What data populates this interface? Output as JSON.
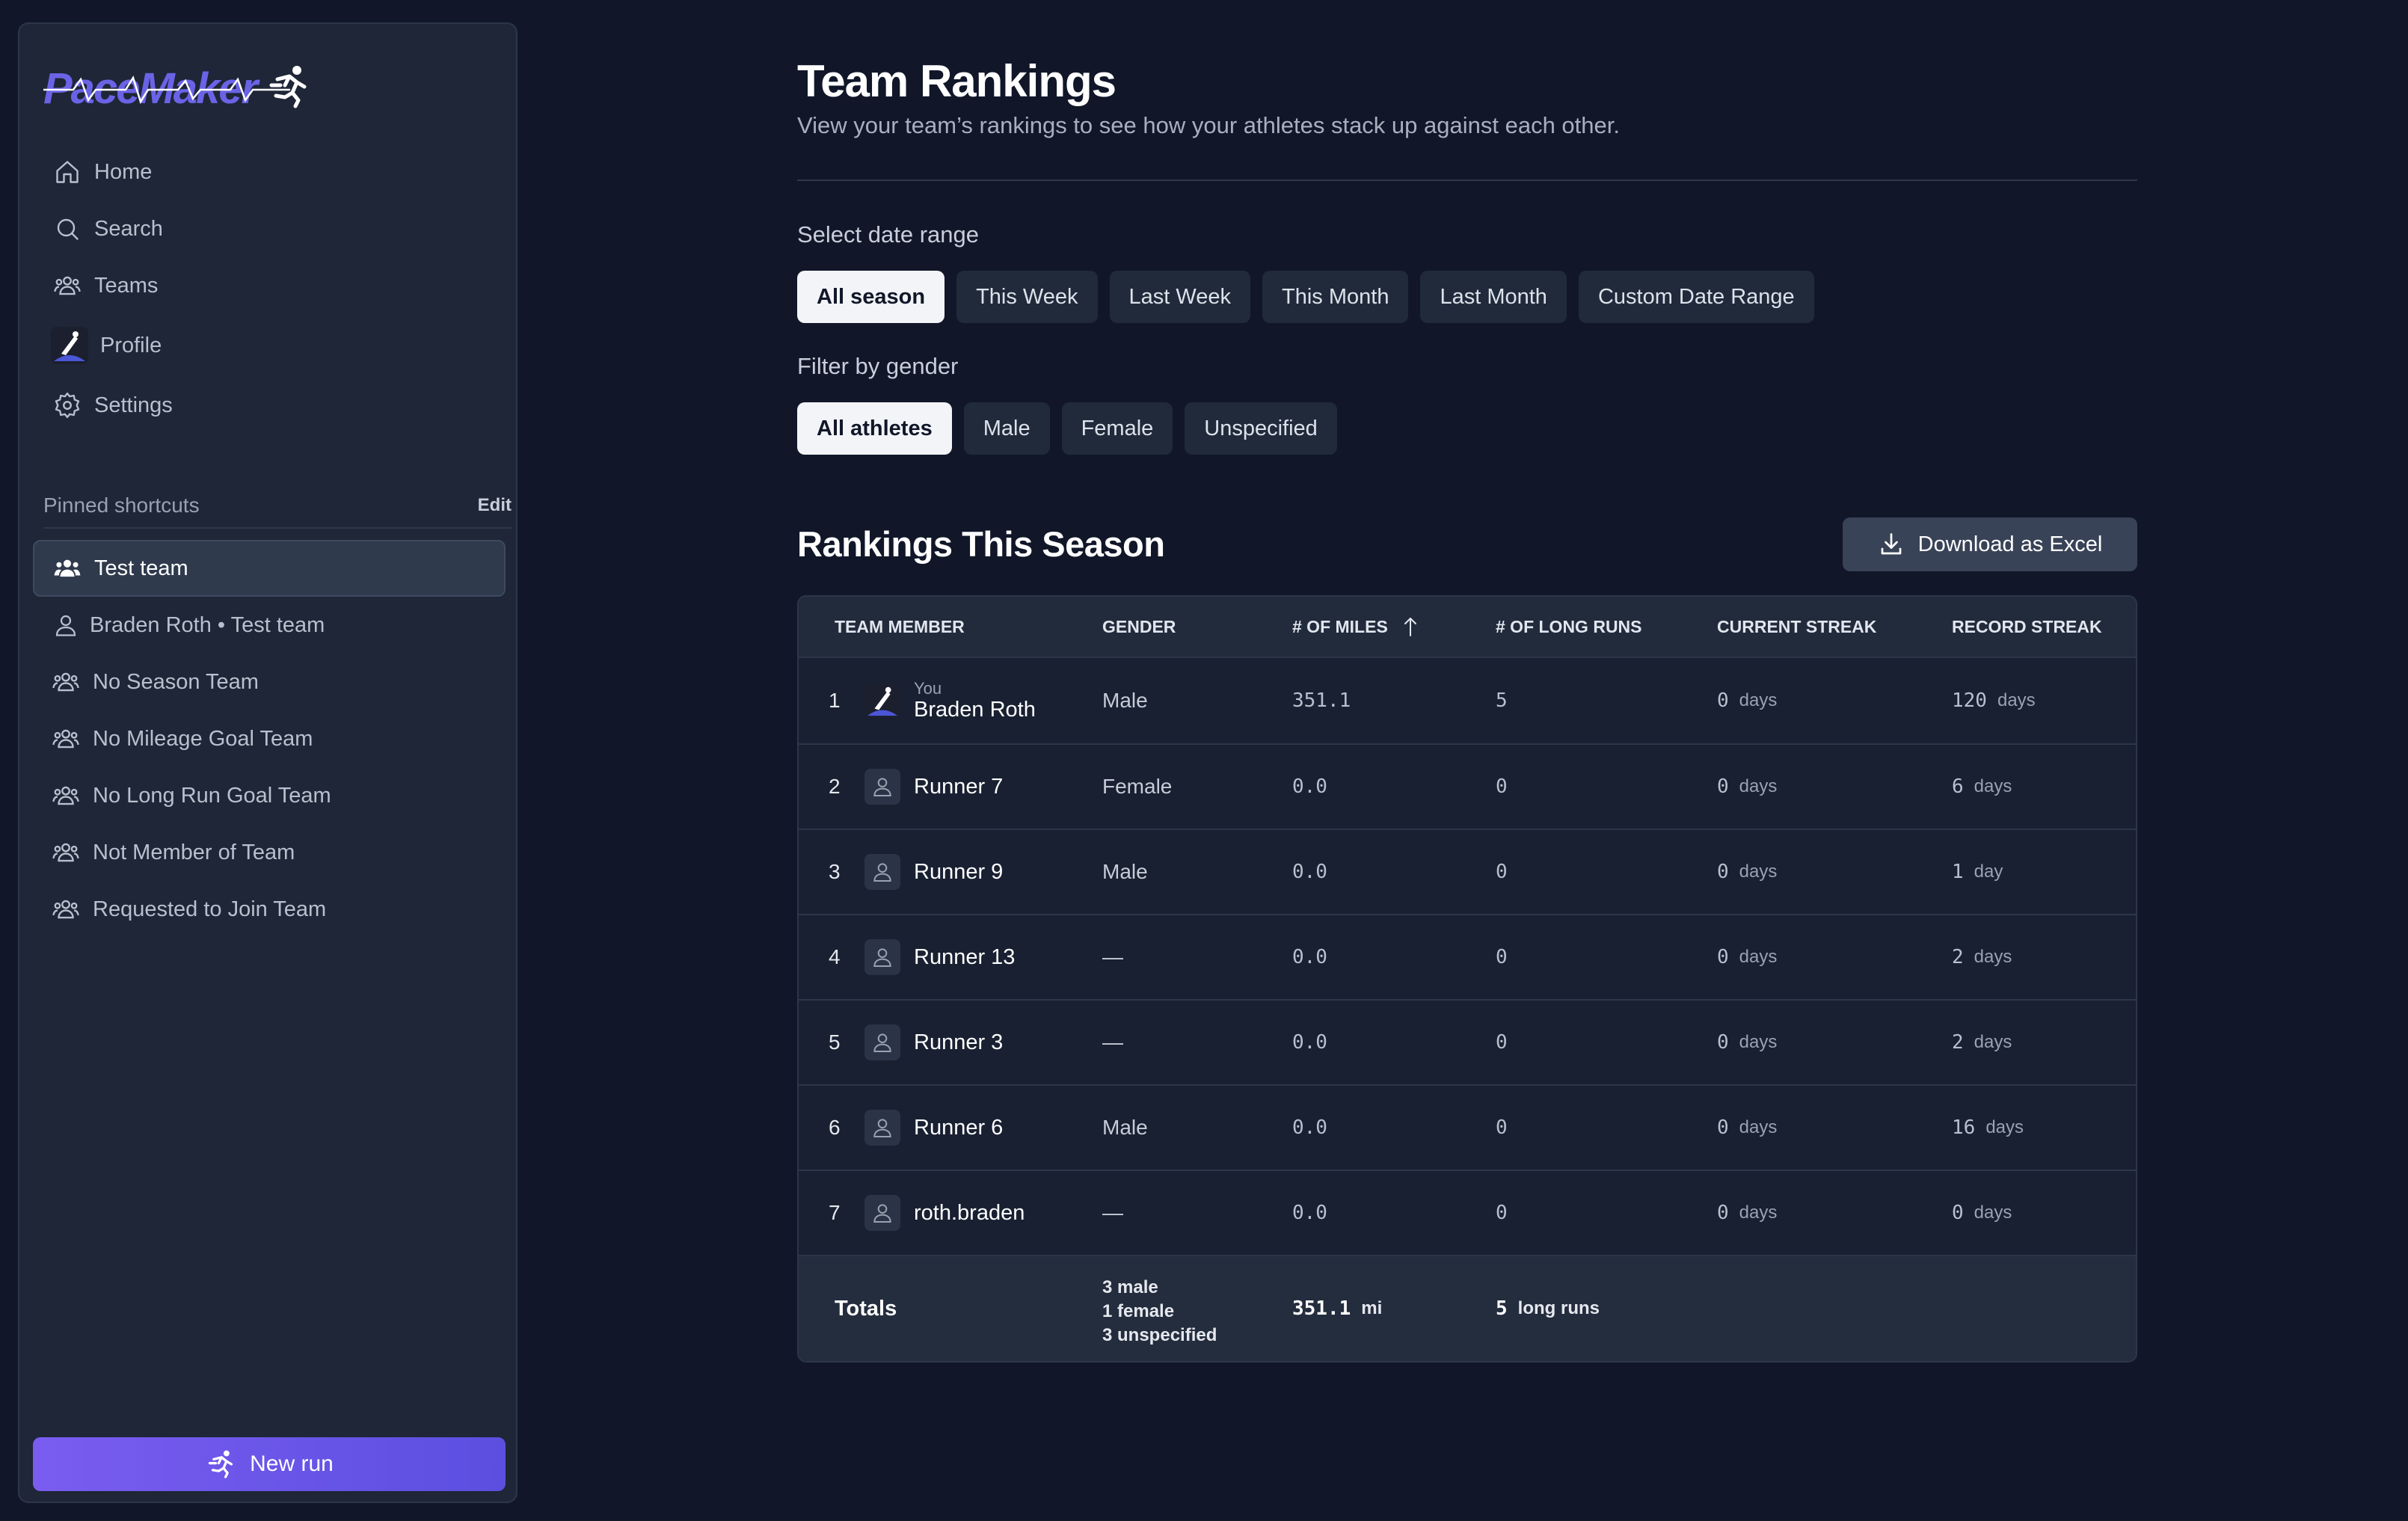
{
  "app": {
    "logo_text": "PaceMaker"
  },
  "nav": [
    {
      "label": "Home",
      "icon": "home-icon"
    },
    {
      "label": "Search",
      "icon": "search-icon"
    },
    {
      "label": "Teams",
      "icon": "users-icon"
    },
    {
      "label": "Profile",
      "icon": "avatar"
    },
    {
      "label": "Settings",
      "icon": "gear-icon"
    }
  ],
  "pinned": {
    "heading": "Pinned shortcuts",
    "edit_label": "Edit",
    "items": [
      {
        "label": "Test team",
        "active": true
      },
      {
        "label": "Braden Roth • Test team"
      },
      {
        "label": "No Season Team"
      },
      {
        "label": "No Mileage Goal Team"
      },
      {
        "label": "No Long Run Goal Team"
      },
      {
        "label": "Not Member of Team"
      },
      {
        "label": "Requested to Join Team"
      }
    ]
  },
  "new_run_label": "New run",
  "page": {
    "title": "Team Rankings",
    "subtitle": "View your team’s rankings to see how your athletes stack up against each other."
  },
  "date_range": {
    "label": "Select date range",
    "options": [
      "All season",
      "This Week",
      "Last Week",
      "This Month",
      "Last Month",
      "Custom Date Range"
    ],
    "selected": "All season"
  },
  "gender_filter": {
    "label": "Filter by gender",
    "options": [
      "All athletes",
      "Male",
      "Female",
      "Unspecified"
    ],
    "selected": "All athletes"
  },
  "rankings": {
    "title": "Rankings This Season",
    "download_label": "Download as Excel",
    "columns": [
      "TEAM MEMBER",
      "GENDER",
      "# OF MILES",
      "# OF LONG RUNS",
      "CURRENT STREAK",
      "RECORD STREAK"
    ],
    "sorted_column": "# OF MILES",
    "rows": [
      {
        "rank": "1",
        "you": "You",
        "name": "Braden Roth",
        "gender": "Male",
        "miles": "351.1",
        "long_runs": "5",
        "current": "0",
        "current_unit": "days",
        "record": "120",
        "record_unit": "days"
      },
      {
        "rank": "2",
        "name": "Runner 7",
        "gender": "Female",
        "miles": "0.0",
        "long_runs": "0",
        "current": "0",
        "current_unit": "days",
        "record": "6",
        "record_unit": "days"
      },
      {
        "rank": "3",
        "name": "Runner 9",
        "gender": "Male",
        "miles": "0.0",
        "long_runs": "0",
        "current": "0",
        "current_unit": "days",
        "record": "1",
        "record_unit": "day"
      },
      {
        "rank": "4",
        "name": "Runner 13",
        "gender": "—",
        "miles": "0.0",
        "long_runs": "0",
        "current": "0",
        "current_unit": "days",
        "record": "2",
        "record_unit": "days"
      },
      {
        "rank": "5",
        "name": "Runner 3",
        "gender": "—",
        "miles": "0.0",
        "long_runs": "0",
        "current": "0",
        "current_unit": "days",
        "record": "2",
        "record_unit": "days"
      },
      {
        "rank": "6",
        "name": "Runner 6",
        "gender": "Male",
        "miles": "0.0",
        "long_runs": "0",
        "current": "0",
        "current_unit": "days",
        "record": "16",
        "record_unit": "days"
      },
      {
        "rank": "7",
        "name": "roth.braden",
        "gender": "—",
        "miles": "0.0",
        "long_runs": "0",
        "current": "0",
        "current_unit": "days",
        "record": "0",
        "record_unit": "days"
      }
    ],
    "totals": {
      "label": "Totals",
      "gender_lines": [
        "3 male",
        "1 female",
        "3 unspecified"
      ],
      "miles": "351.1",
      "miles_unit": "mi",
      "long_runs": "5",
      "long_runs_unit": "long runs"
    }
  },
  "colors": {
    "background": "#111729",
    "sidebar": "#1e2637",
    "accent": "#6a63e6",
    "new_run_gradient_start": "#7a5cf0",
    "new_run_gradient_end": "#5b4fe0"
  }
}
